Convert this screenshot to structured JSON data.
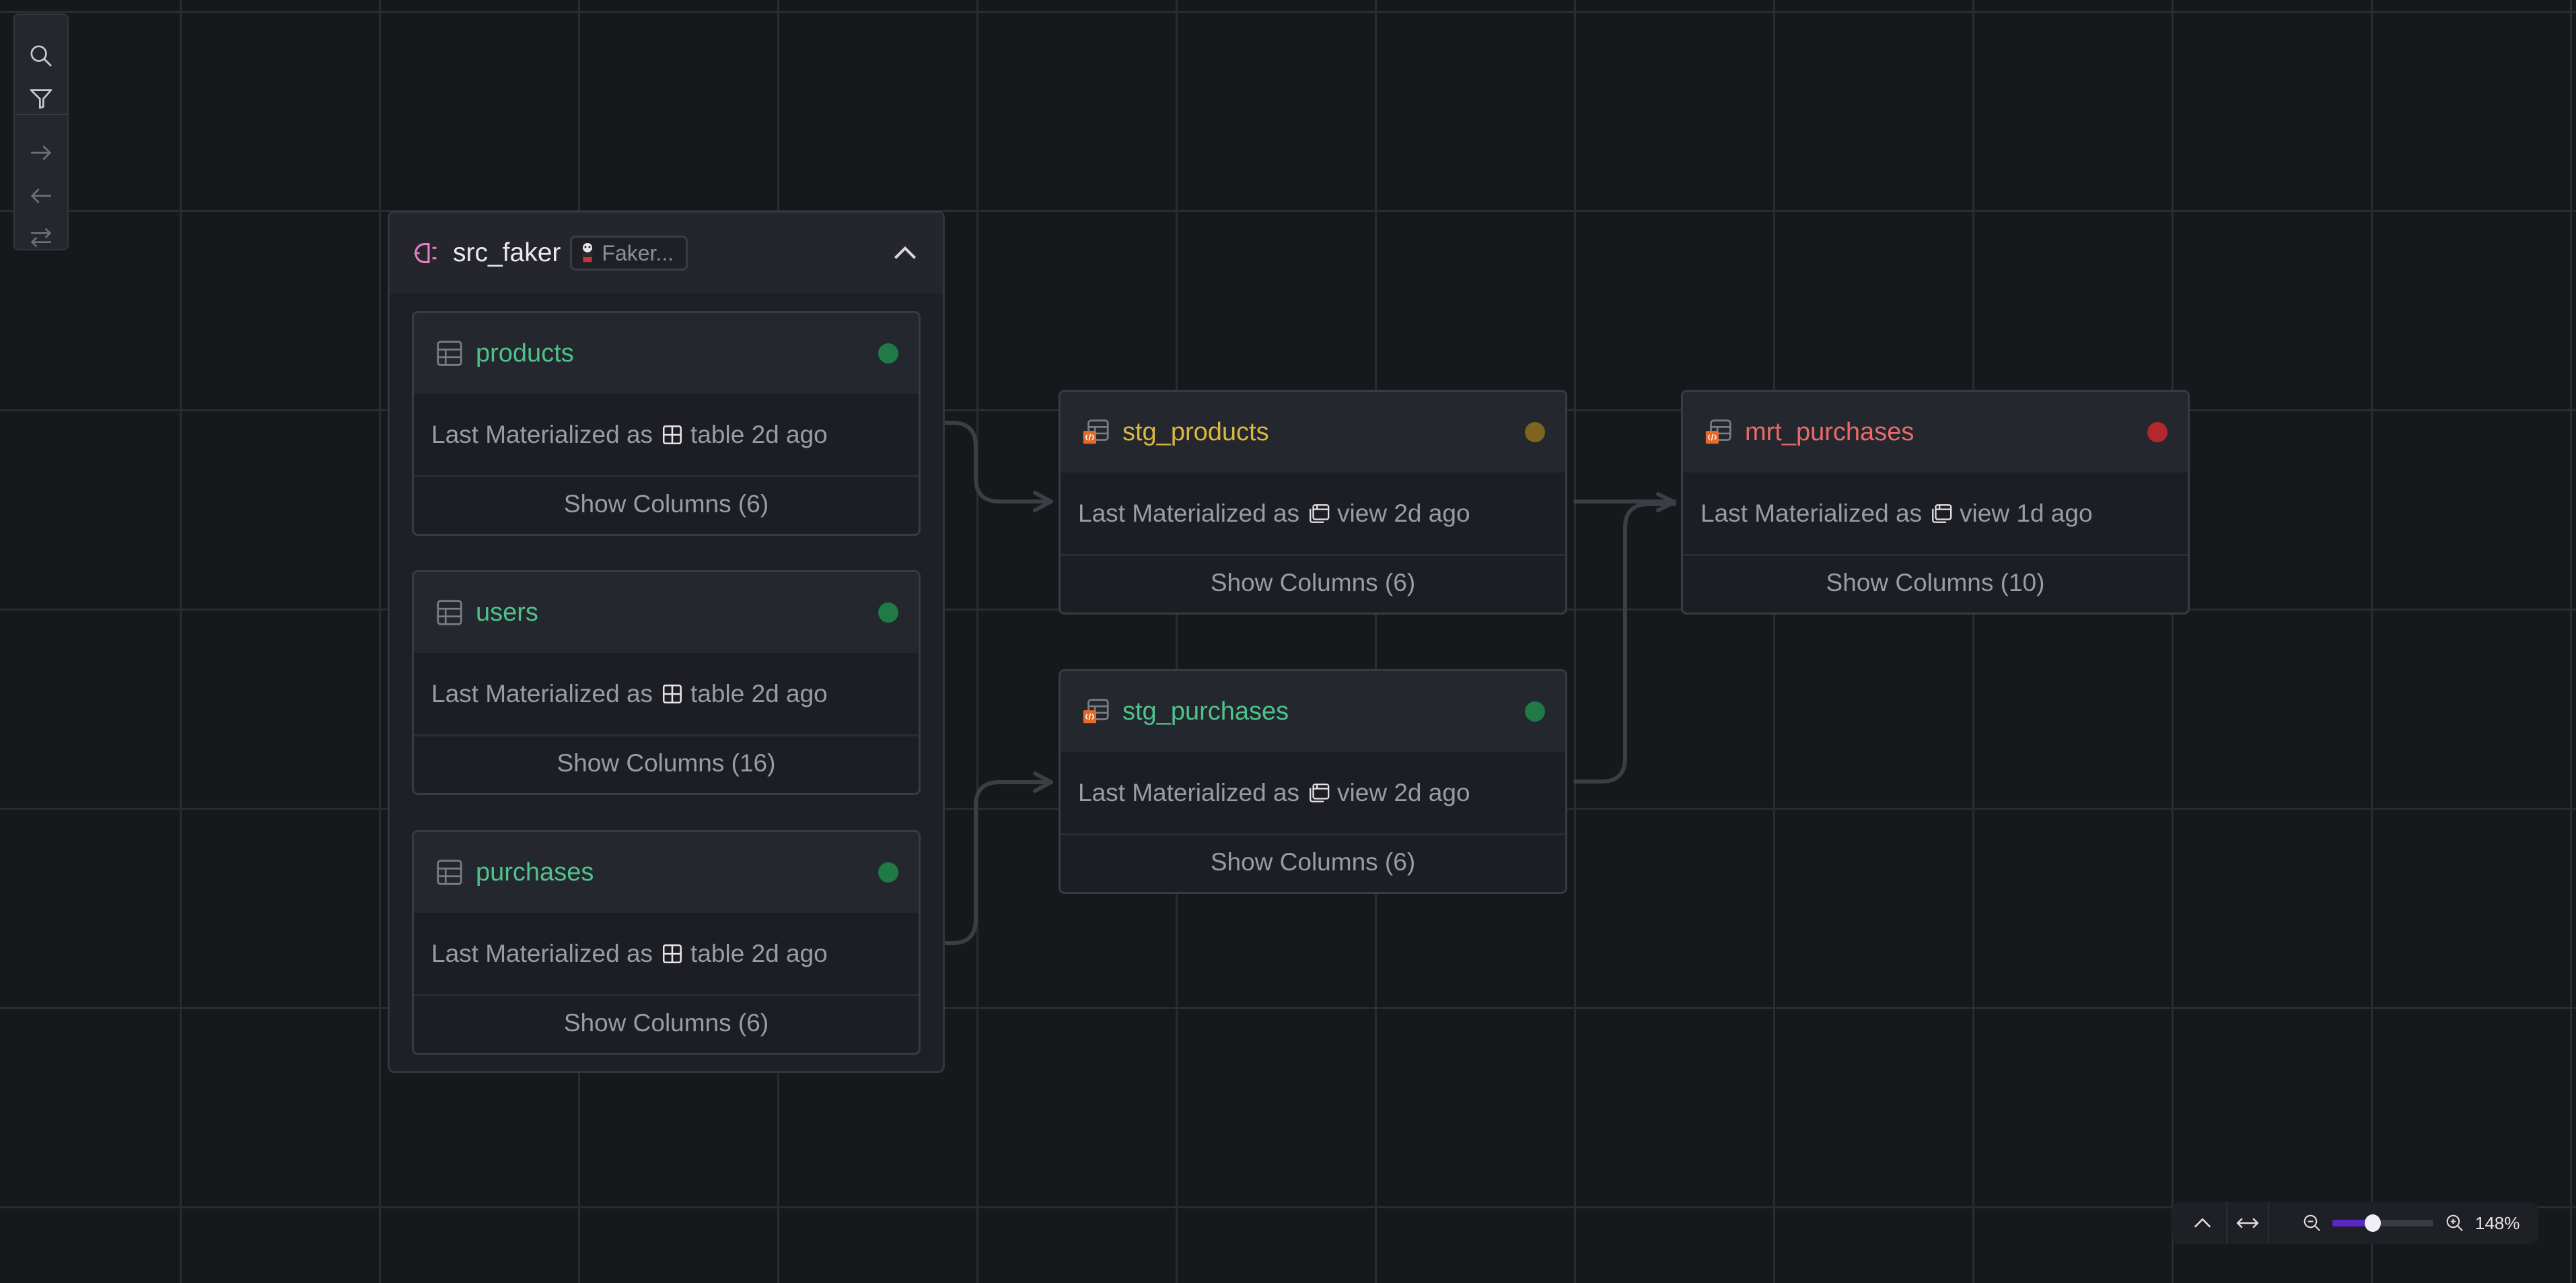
{
  "toolbar": {
    "items": [
      {
        "name": "search",
        "icon": "search-icon"
      },
      {
        "name": "filter",
        "icon": "filter-icon"
      },
      {
        "name": "expand-downstream",
        "icon": "arrow-right-icon"
      },
      {
        "name": "expand-upstream",
        "icon": "arrow-left-icon"
      },
      {
        "name": "expand-both",
        "icon": "arrows-exchange-icon"
      }
    ]
  },
  "group": {
    "title": "src_faker",
    "icon": "source-connector-icon",
    "badge": "Faker...",
    "badge_icon": "magic-hat-icon",
    "collapse_icon": "chevron-up-icon",
    "nodes": [
      {
        "name": "products",
        "title": "products",
        "title_color": "#4fc28b",
        "status_color": "#1f7a46",
        "status": "success",
        "mat_prefix": "Last Materialized as",
        "mat_type": "table",
        "mat_time": "2d ago",
        "mat_icon": "table-grid-icon",
        "columns_label": "Show Columns (6)"
      },
      {
        "name": "users",
        "title": "users",
        "title_color": "#4fc28b",
        "status_color": "#1f7a46",
        "status": "success",
        "mat_prefix": "Last Materialized as",
        "mat_type": "table",
        "mat_time": "2d ago",
        "mat_icon": "table-grid-icon",
        "columns_label": "Show Columns (16)"
      },
      {
        "name": "purchases",
        "title": "purchases",
        "title_color": "#4fc28b",
        "status_color": "#1f7a46",
        "status": "success",
        "mat_prefix": "Last Materialized as",
        "mat_type": "table",
        "mat_time": "2d ago",
        "mat_icon": "table-grid-icon",
        "columns_label": "Show Columns (6)"
      }
    ]
  },
  "models": [
    {
      "name": "stg_products",
      "title": "stg_products",
      "title_color": "#d9b83f",
      "status_color": "#7d6420",
      "status": "warning",
      "mat_prefix": "Last Materialized as",
      "mat_type": "view",
      "mat_time": "2d ago",
      "mat_icon": "view-window-icon",
      "columns_label": "Show Columns (6)"
    },
    {
      "name": "stg_purchases",
      "title": "stg_purchases",
      "title_color": "#4fc28b",
      "status_color": "#1f7a46",
      "status": "success",
      "mat_prefix": "Last Materialized as",
      "mat_type": "view",
      "mat_time": "2d ago",
      "mat_icon": "view-window-icon",
      "columns_label": "Show Columns (6)"
    },
    {
      "name": "mrt_purchases",
      "title": "mrt_purchases",
      "title_color": "#e96a6a",
      "status_color": "#b3282f",
      "status": "error",
      "mat_prefix": "Last Materialized as",
      "mat_type": "view",
      "mat_time": "1d ago",
      "mat_icon": "view-window-icon",
      "columns_label": "Show Columns (10)"
    }
  ],
  "edges": [
    {
      "from": "products",
      "to": "stg_products"
    },
    {
      "from": "purchases",
      "to": "stg_purchases"
    },
    {
      "from": "stg_products",
      "to": "mrt_purchases"
    },
    {
      "from": "stg_purchases",
      "to": "mrt_purchases"
    }
  ],
  "controls": {
    "zoom_percent": 148,
    "zoom_label": "148%",
    "zoom_slider_fraction": 0.4,
    "accent": "#5b27c4"
  }
}
